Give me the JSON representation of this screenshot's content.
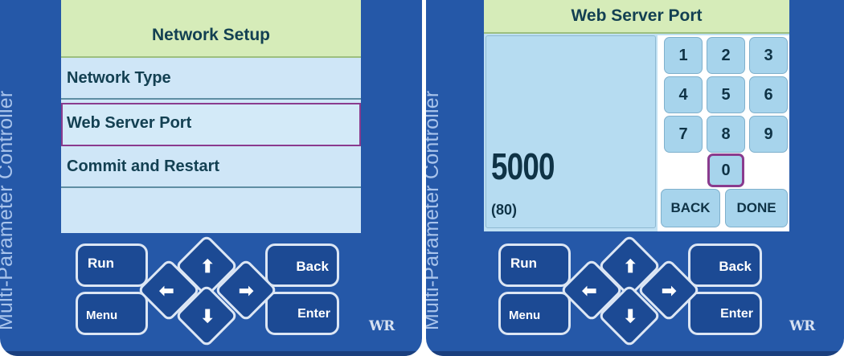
{
  "device_label": "Multi-Parameter Controller",
  "logo_text": "WR",
  "left_panel": {
    "title": "Network Setup",
    "menu_items": [
      {
        "label": "Network Type"
      },
      {
        "label": "Web Server Port",
        "selected": true
      },
      {
        "label": "Commit and Restart"
      },
      {
        "label": ""
      }
    ]
  },
  "right_panel": {
    "title": "Web Server Port",
    "value": "5000",
    "default_value": "(80)",
    "keys": [
      "1",
      "2",
      "3",
      "4",
      "5",
      "6",
      "7",
      "8",
      "9",
      "0"
    ],
    "selected_key": "0",
    "back_label": "BACK",
    "done_label": "DONE"
  },
  "buttons": {
    "run": "Run",
    "back": "Back",
    "menu": "Menu",
    "enter": "Enter",
    "up_icon": "arrow-up-icon",
    "down_icon": "arrow-down-icon",
    "left_icon": "arrow-left-icon",
    "right_icon": "arrow-right-icon"
  },
  "colors": {
    "device_blue": "#2558a8",
    "screen_blue": "#cfe6f7",
    "title_green": "#d6ecb9",
    "selection_purple": "#8a3b8e"
  }
}
